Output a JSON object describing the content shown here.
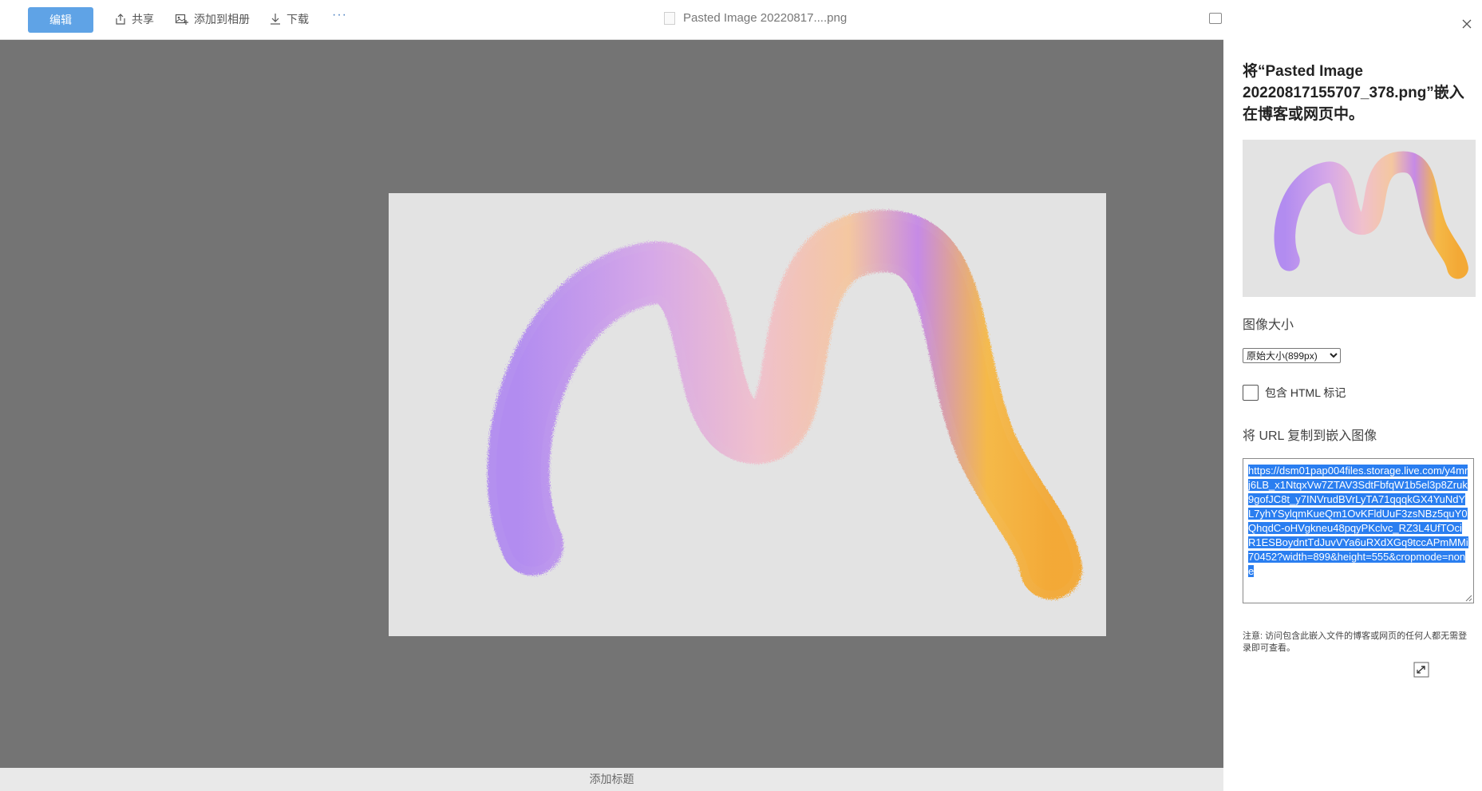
{
  "toolbar": {
    "edit_label": "编辑",
    "share_label": "共享",
    "add_album_label": "添加到相册",
    "download_label": "下载",
    "more_label": "···",
    "file_title": "Pasted Image 20220817....png"
  },
  "viewer": {
    "caption_placeholder": "添加标题"
  },
  "panel": {
    "title": "将“Pasted Image 20220817155707_378.png”嵌入在博客或网页中。",
    "size_label": "图像大小",
    "size_selected": "原始大小(899px)",
    "include_html_label": "包含 HTML 标记",
    "include_html_checked": false,
    "url_label": "将 URL 复制到嵌入图像",
    "embed_url": "https://dsm01pap004files.storage.live.com/y4mrj6LB_x1NtqxVw7ZTAV3SdtFbfqW1b5el3p8Zruk9gofJC8t_y7INVrudBVrLyTA71qqqkGX4YuNdYL7yhYSylqmKueQm1OvKFldUuF3zsNBz5quY0QhqdC-oHVgkneu48pqyPKclvc_RZ3L4UfTOciR1ESBoydntTdJuvVYa6uRXdXGq9tccAPmMMi70452?width=899&height=555&cropmode=none",
    "note": "注意: 访问包含此嵌入文件的博客或网页的任何人都无需登录即可查看。"
  },
  "icons": {
    "share": "share-icon",
    "album": "add-to-album-icon",
    "download": "download-icon",
    "close": "close-icon",
    "doc": "file-icon",
    "copy": "copy-link-icon"
  },
  "colors": {
    "edit_button": "#5fa3e6",
    "viewer_background": "#747474",
    "selection": "#2a7ef0"
  }
}
